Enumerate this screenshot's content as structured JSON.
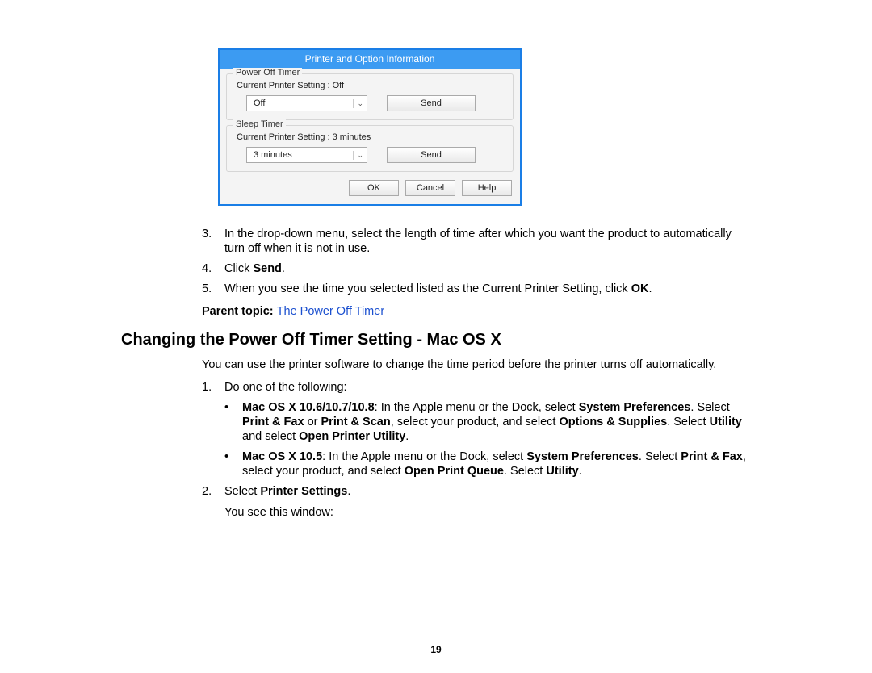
{
  "dialog": {
    "title": "Printer and Option Information",
    "group1": {
      "label": "Power Off Timer",
      "current": "Current Printer Setting : Off",
      "dropdown": "Off",
      "send": "Send"
    },
    "group2": {
      "label": "Sleep Timer",
      "current": "Current Printer Setting : 3 minutes",
      "dropdown": "3 minutes",
      "send": "Send"
    },
    "buttons": {
      "ok": "OK",
      "cancel": "Cancel",
      "help": "Help"
    }
  },
  "list1": {
    "n3": "3.",
    "t3": "In the drop-down menu, select the length of time after which you want the product to automatically turn off when it is not in use.",
    "n4": "4.",
    "t4_a": "Click ",
    "t4_b": "Send",
    "t4_c": ".",
    "n5": "5.",
    "t5_a": "When you see the time you selected listed as the Current Printer Setting, click ",
    "t5_b": "OK",
    "t5_c": "."
  },
  "parent": {
    "label": "Parent topic: ",
    "link": "The Power Off Timer"
  },
  "heading": "Changing the Power Off Timer Setting - Mac OS X",
  "intro": "You can use the printer software to change the time period before the printer turns off automatically.",
  "list2": {
    "n1": "1.",
    "t1": "Do one of the following:",
    "b1": {
      "a": "Mac OS X 10.6/10.7/10.8",
      "b": ": In the Apple menu or the Dock, select ",
      "c": "System Preferences",
      "d": ". Select ",
      "e": "Print & Fax",
      "f": " or ",
      "g": "Print & Scan",
      "h": ", select your product, and select ",
      "i": "Options & Supplies",
      "j": ". Select ",
      "k": "Utility",
      "l": " and select ",
      "m": "Open Printer Utility",
      "n": "."
    },
    "b2": {
      "a": "Mac OS X 10.5",
      "b": ": In the Apple menu or the Dock, select ",
      "c": "System Preferences",
      "d": ". Select ",
      "e": "Print & Fax",
      "f": ", select your product, and select ",
      "g": "Open Print Queue",
      "h": ". Select ",
      "i": "Utility",
      "j": "."
    },
    "n2": "2.",
    "t2_a": "Select ",
    "t2_b": "Printer Settings",
    "t2_c": ".",
    "t2b": "You see this window:"
  },
  "pageNumber": "19"
}
